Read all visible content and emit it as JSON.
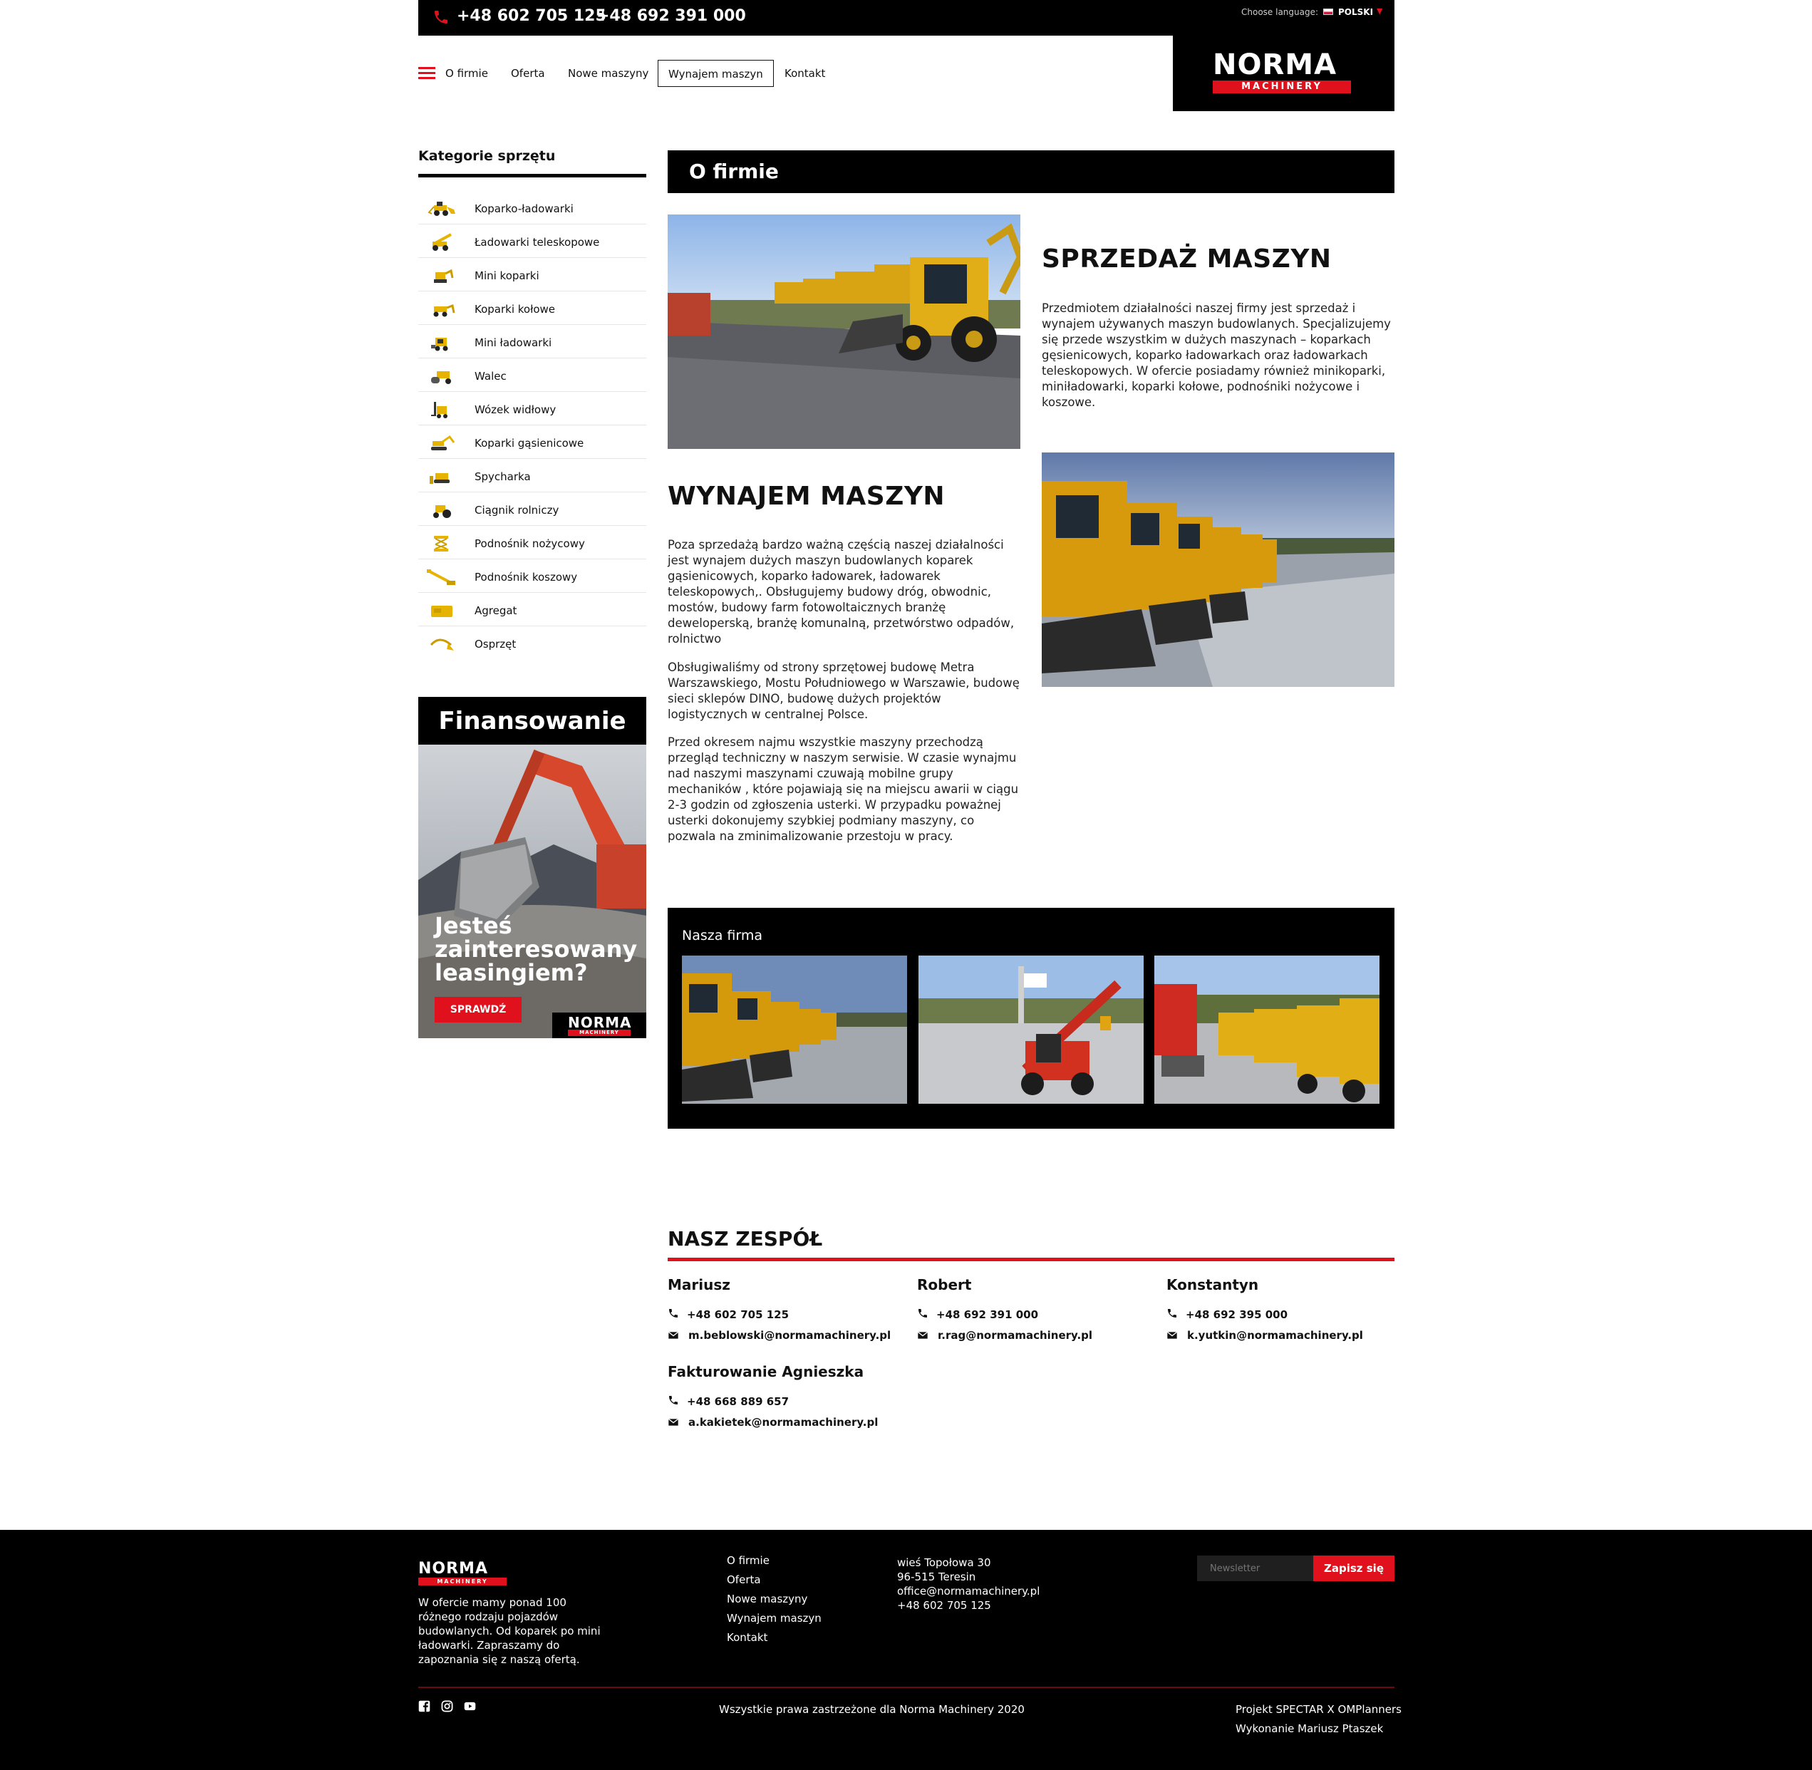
{
  "topbar": {
    "phone1": "+48 602 705 125",
    "phone2": "+48 692 391 000",
    "language_label": "Choose language:",
    "language_value": "POLSKI"
  },
  "nav": {
    "items": [
      "O firmie",
      "Oferta",
      "Nowe maszyny",
      "Wynajem maszyn",
      "Kontakt"
    ],
    "active": "Wynajem maszyn"
  },
  "logo": {
    "line1": "NORMA",
    "line2": "MACHINERY"
  },
  "sidebar": {
    "title": "Kategorie sprzętu",
    "categories": [
      "Koparko-ładowarki",
      "Ładowarki teleskopowe",
      "Mini koparki",
      "Koparki kołowe",
      "Mini ładowarki",
      "Walec",
      "Wózek widłowy",
      "Koparki gąsienicowe",
      "Spycharka",
      "Ciągnik rolniczy",
      "Podnośnik nożycowy",
      "Podnośnik koszowy",
      "Agregat",
      "Osprzęt"
    ],
    "finance": {
      "title": "Finansowanie",
      "text": "Jesteś zainteresowany leasingiem?",
      "button": "SPRAWDŹ"
    }
  },
  "main": {
    "heading": "O firmie",
    "sales": {
      "title": "SPRZEDAŻ MASZYN",
      "text": "Przedmiotem działalności naszej firmy jest sprzedaż i wynajem używanych maszyn budowlanych. Specjalizujemy się przede wszystkim w dużych maszynach – koparkach gęsienicowych, koparko ładowarkach oraz ładowarkach teleskopowych. W ofercie posiadamy również minikoparki, miniładowarki, koparki kołowe, podnośniki nożycowe i koszowe."
    },
    "rent": {
      "title": "WYNAJEM MASZYN",
      "p1": "Poza sprzedażą bardzo ważną częścią naszej działalności jest wynajem dużych maszyn budowlanych koparek gąsienicowych, koparko ładowarek, ładowarek teleskopowych,. Obsługujemy budowy dróg, obwodnic, mostów, budowy farm fotowoltaicznych branżę deweloperską, branżę komunalną, przetwórstwo odpadów, rolnictwo",
      "p2": "Obsługiwaliśmy od strony sprzętowej budowę Metra Warszawskiego, Mostu Południowego w Warszawie, budowę sieci sklepów DINO, budowę dużych projektów logistycznych w centralnej Polsce.",
      "p3": "Przed okresem najmu wszystkie maszyny przechodzą przegląd techniczny w naszym serwisie. W czasie wynajmu nad naszymi maszynami czuwają mobilne grupy mechaników , które pojawiają się na miejscu awarii w ciągu 2-3 godzin od zgłoszenia usterki. W przypadku poważnej usterki dokonujemy szybkiej podmiany maszyny, co pozwala na zminimalizowanie przestoju w pracy."
    },
    "gallery_title": "Nasza firma"
  },
  "team": {
    "title": "NASZ ZESPÓŁ",
    "members": [
      {
        "name": "Mariusz",
        "phone": "+48 602 705 125",
        "email": "m.beblowski@normamachinery.pl"
      },
      {
        "name": "Robert",
        "phone": "+48 692 391 000",
        "email": "r.rag@normamachinery.pl"
      },
      {
        "name": "Konstantyn",
        "phone": "+48 692 395 000",
        "email": "k.yutkin@normamachinery.pl"
      },
      {
        "name": "Fakturowanie Agnieszka",
        "phone": "+48 668 889 657",
        "email": "a.kakietek@normamachinery.pl"
      }
    ]
  },
  "footer": {
    "description": "W ofercie mamy ponad 100 różnego rodzaju pojazdów budowlanych. Od koparek po mini ładowarki. Zapraszamy do zapoznania się z naszą ofertą.",
    "links": [
      "O firmie",
      "Oferta",
      "Nowe maszyny",
      "Wynajem maszyn",
      "Kontakt"
    ],
    "address": [
      "wieś Topołowa 30",
      "96-515 Teresin",
      "office@normamachinery.pl",
      "+48 602 705 125"
    ],
    "newsletter_placeholder": "Newsletter",
    "newsletter_button": "Zapisz się",
    "copyright": "Wszystkie prawa zastrzeżone dla Norma Machinery 2020",
    "credit1": "Projekt SPECTAR X OMPlanners",
    "credit2": "Wykonanie Mariusz Ptaszek"
  },
  "colors": {
    "accent": "#e0101c",
    "dark": "#000000",
    "text": "#111111"
  }
}
